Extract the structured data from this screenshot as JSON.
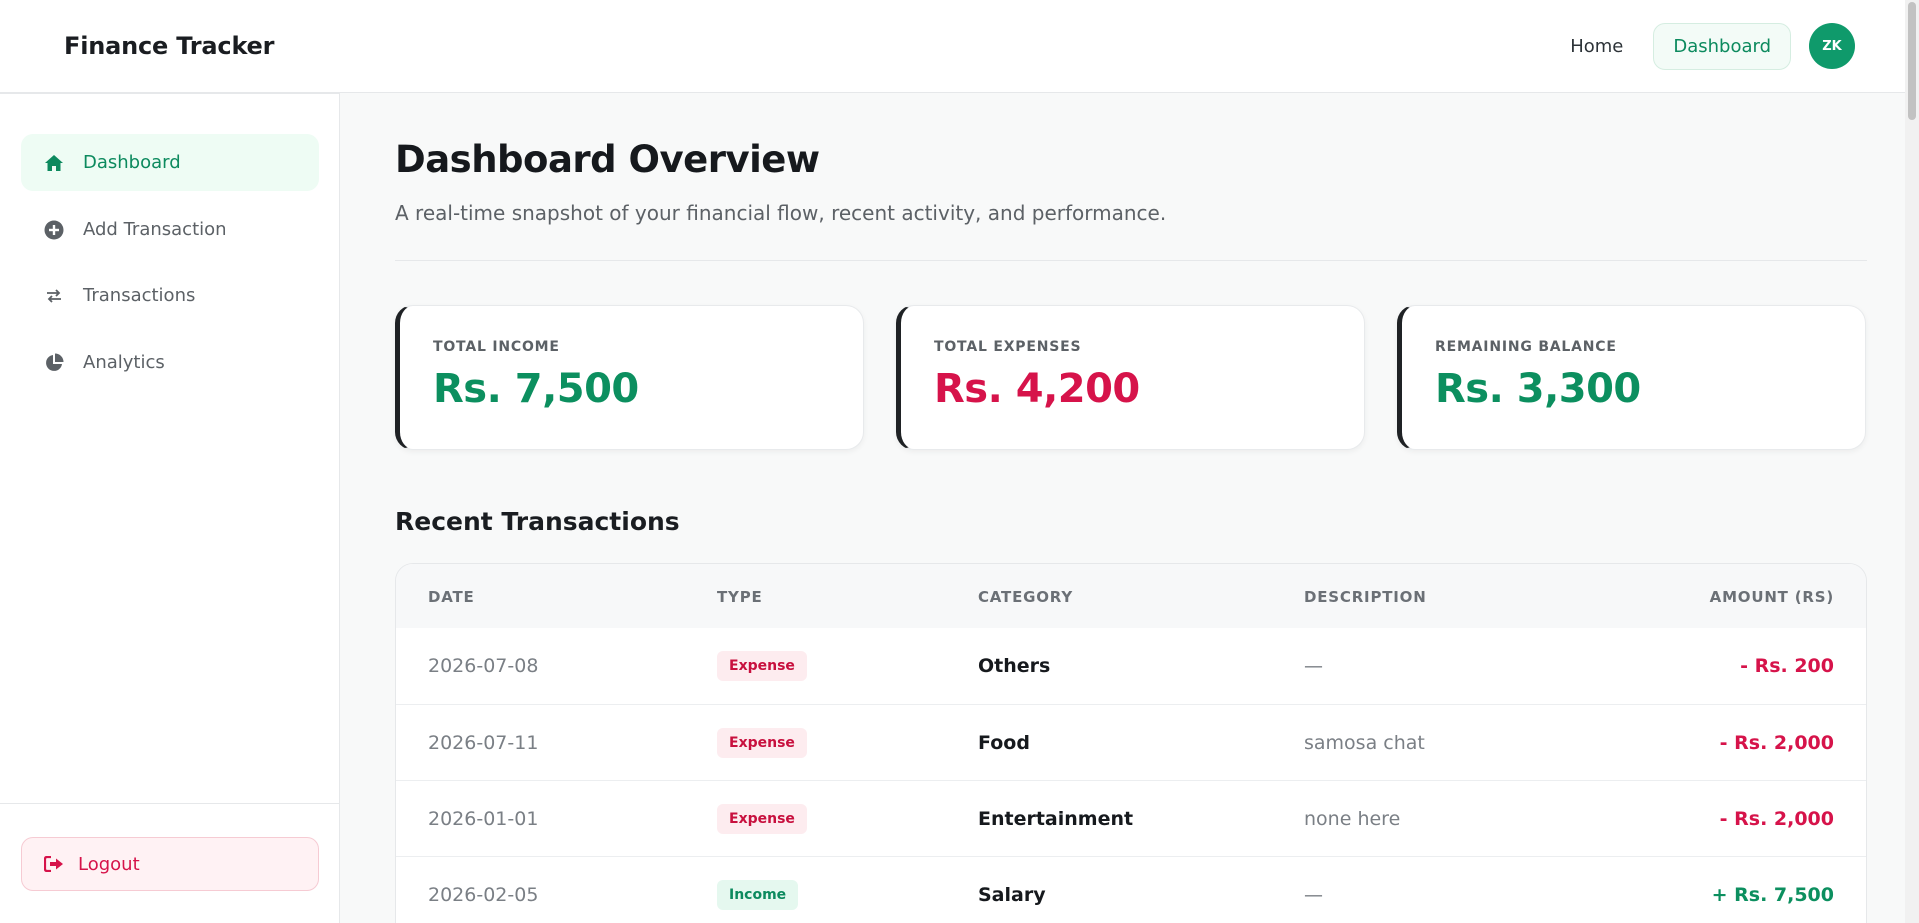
{
  "header": {
    "brand": "Finance Tracker",
    "nav_home": "Home",
    "nav_dashboard": "Dashboard",
    "avatar_initials": "ZK"
  },
  "sidebar": {
    "items": [
      {
        "label": "Dashboard",
        "icon": "home-icon",
        "active": true
      },
      {
        "label": "Add Transaction",
        "icon": "plus-circle-icon",
        "active": false
      },
      {
        "label": "Transactions",
        "icon": "swap-arrows-icon",
        "active": false
      },
      {
        "label": "Analytics",
        "icon": "pie-chart-icon",
        "active": false
      }
    ],
    "logout_label": "Logout",
    "logout_icon": "sign-out-icon"
  },
  "main": {
    "title": "Dashboard Overview",
    "subtitle": "A real-time snapshot of your financial flow, recent activity, and performance.",
    "cards": [
      {
        "label": "TOTAL INCOME",
        "value": "Rs. 7,500",
        "color": "#0c8f5f"
      },
      {
        "label": "TOTAL EXPENSES",
        "value": "Rs. 4,200",
        "color": "#d6134a"
      },
      {
        "label": "REMAINING BALANCE",
        "value": "Rs. 3,300",
        "color": "#0c8f5f"
      }
    ],
    "recent_title": "Recent Transactions",
    "table": {
      "headers": [
        "DATE",
        "TYPE",
        "CATEGORY",
        "DESCRIPTION",
        "AMOUNT (RS)"
      ],
      "rows": [
        {
          "date": "2026-07-08",
          "type": "Expense",
          "category": "Others",
          "description": "—",
          "amount": "- Rs. 200"
        },
        {
          "date": "2026-07-11",
          "type": "Expense",
          "category": "Food",
          "description": "samosa chat",
          "amount": "- Rs. 2,000"
        },
        {
          "date": "2026-01-01",
          "type": "Expense",
          "category": "Entertainment",
          "description": "none here",
          "amount": "- Rs. 2,000"
        },
        {
          "date": "2026-02-05",
          "type": "Income",
          "category": "Salary",
          "description": "—",
          "amount": "+ Rs. 7,500"
        }
      ]
    }
  },
  "colors": {
    "accent": "#0c8a5e",
    "expense": "#d6134a",
    "income": "#0c8f5f"
  }
}
